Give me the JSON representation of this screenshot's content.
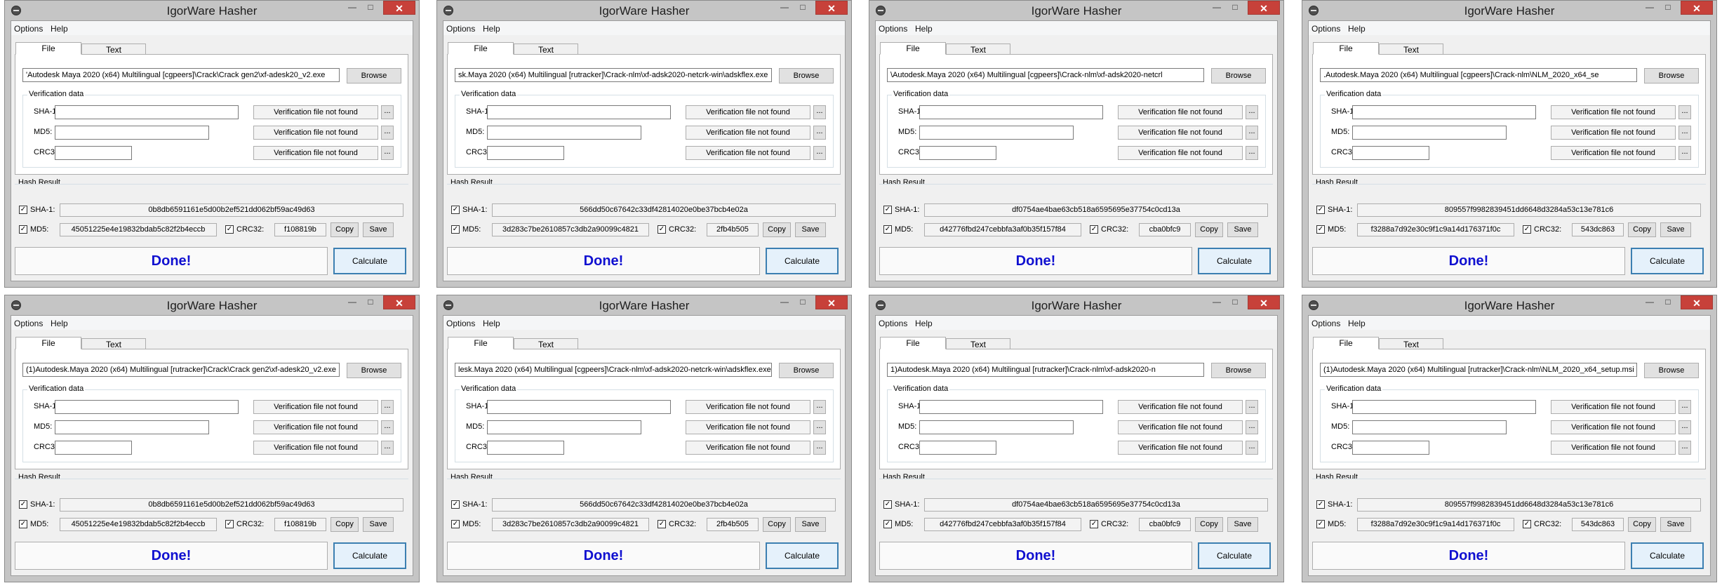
{
  "colors": {
    "accent": "#3c7fb1",
    "done_text": "#1010d0",
    "close_button": "#c7413a"
  },
  "windows": [
    {
      "title": "IgorWare Hasher",
      "menu": [
        "Options",
        "Help"
      ],
      "tabs": [
        "File",
        "Text"
      ],
      "file_path": "'Autodesk Maya 2020 (x64) Multilingual [cgpeers]\\Crack\\Crack gen2\\xf-adesk20_v2.exe",
      "browse_label": "Browse",
      "verification_title": "Verification data",
      "sha1_label": "SHA-1:",
      "md5_label": "MD5:",
      "crc32_label": "CRC32:",
      "verif_status": "Verification file not found",
      "dots_label": "...",
      "hash_result_title": "Hash Result",
      "sha1_hash": "0b8db6591161e5d00b2ef521dd062bf59ac49d63",
      "md5_hash": "45051225e4e19832bdab5c82f2b4eccb",
      "crc32_hash": "f108819b",
      "copy_label": "Copy",
      "save_label": "Save",
      "status": "Done!",
      "calculate_label": "Calculate",
      "minimize_icon": "minimize-icon",
      "maximize_icon": "maximize-icon",
      "close_icon": "close-icon"
    },
    {
      "title": "IgorWare Hasher",
      "menu": [
        "Options",
        "Help"
      ],
      "tabs": [
        "File",
        "Text"
      ],
      "file_path": "sk.Maya 2020 (x64) Multilingual [rutracker]\\Crack-nlm\\xf-adsk2020-netcrk-win\\adskflex.exe",
      "browse_label": "Browse",
      "verification_title": "Verification data",
      "sha1_label": "SHA-1:",
      "md5_label": "MD5:",
      "crc32_label": "CRC32:",
      "verif_status": "Verification file not found",
      "dots_label": "...",
      "hash_result_title": "Hash Result",
      "sha1_hash": "566dd50c67642c33df42814020e0be37bcb4e02a",
      "md5_hash": "3d283c7be2610857c3db2a90099c4821",
      "crc32_hash": "2fb4b505",
      "copy_label": "Copy",
      "save_label": "Save",
      "status": "Done!",
      "calculate_label": "Calculate",
      "minimize_icon": "minimize-icon",
      "maximize_icon": "maximize-icon",
      "close_icon": "close-icon"
    },
    {
      "title": "IgorWare Hasher",
      "menu": [
        "Options",
        "Help"
      ],
      "tabs": [
        "File",
        "Text"
      ],
      "file_path": "\\Autodesk.Maya 2020 (x64) Multilingual [cgpeers]\\Crack-nlm\\xf-adsk2020-netcrl",
      "browse_label": "Browse",
      "verification_title": "Verification data",
      "sha1_label": "SHA-1:",
      "md5_label": "MD5:",
      "crc32_label": "CRC32:",
      "verif_status": "Verification file not found",
      "dots_label": "...",
      "hash_result_title": "Hash Result",
      "sha1_hash": "df0754ae4bae63cb518a6595695e37754c0cd13a",
      "md5_hash": "d42776fbd247cebbfa3af0b35f157f84",
      "crc32_hash": "cba0bfc9",
      "copy_label": "Copy",
      "save_label": "Save",
      "status": "Done!",
      "calculate_label": "Calculate",
      "minimize_icon": "minimize-icon",
      "maximize_icon": "maximize-icon",
      "close_icon": "close-icon"
    },
    {
      "title": "IgorWare Hasher",
      "menu": [
        "Options",
        "Help"
      ],
      "tabs": [
        "File",
        "Text"
      ],
      "file_path": ".Autodesk.Maya 2020 (x64) Multilingual [cgpeers]\\Crack-nlm\\NLM_2020_x64_se",
      "browse_label": "Browse",
      "verification_title": "Verification data",
      "sha1_label": "SHA-1:",
      "md5_label": "MD5:",
      "crc32_label": "CRC32:",
      "verif_status": "Verification file not found",
      "dots_label": "...",
      "hash_result_title": "Hash Result",
      "sha1_hash": "809557f9982839451dd6648d3284a53c13e781c6",
      "md5_hash": "f3288a7d92e30c9f1c9a14d176371f0c",
      "crc32_hash": "543dc863",
      "copy_label": "Copy",
      "save_label": "Save",
      "status": "Done!",
      "calculate_label": "Calculate",
      "minimize_icon": "minimize-icon",
      "maximize_icon": "maximize-icon",
      "close_icon": "close-icon"
    },
    {
      "title": "IgorWare Hasher",
      "menu": [
        "Options",
        "Help"
      ],
      "tabs": [
        "File",
        "Text"
      ],
      "file_path": "(1)Autodesk.Maya 2020 (x64) Multilingual [rutracker]\\Crack\\Crack gen2\\xf-adesk20_v2.exe",
      "browse_label": "Browse",
      "verification_title": "Verification data",
      "sha1_label": "SHA-1:",
      "md5_label": "MD5:",
      "crc32_label": "CRC32:",
      "verif_status": "Verification file not found",
      "dots_label": "...",
      "hash_result_title": "Hash Result",
      "sha1_hash": "0b8db6591161e5d00b2ef521dd062bf59ac49d63",
      "md5_hash": "45051225e4e19832bdab5c82f2b4eccb",
      "crc32_hash": "f108819b",
      "copy_label": "Copy",
      "save_label": "Save",
      "status": "Done!",
      "calculate_label": "Calculate",
      "minimize_icon": "minimize-icon",
      "maximize_icon": "maximize-icon",
      "close_icon": "close-icon"
    },
    {
      "title": "IgorWare Hasher",
      "menu": [
        "Options",
        "Help"
      ],
      "tabs": [
        "File",
        "Text"
      ],
      "file_path": "lesk.Maya 2020 (x64) Multilingual [cgpeers]\\Crack-nlm\\xf-adsk2020-netcrk-win\\adskflex.exe",
      "browse_label": "Browse",
      "verification_title": "Verification data",
      "sha1_label": "SHA-1:",
      "md5_label": "MD5:",
      "crc32_label": "CRC32:",
      "verif_status": "Verification file not found",
      "dots_label": "...",
      "hash_result_title": "Hash Result",
      "sha1_hash": "566dd50c67642c33df42814020e0be37bcb4e02a",
      "md5_hash": "3d283c7be2610857c3db2a90099c4821",
      "crc32_hash": "2fb4b505",
      "copy_label": "Copy",
      "save_label": "Save",
      "status": "Done!",
      "calculate_label": "Calculate",
      "minimize_icon": "minimize-icon",
      "maximize_icon": "maximize-icon",
      "close_icon": "close-icon"
    },
    {
      "title": "IgorWare Hasher",
      "menu": [
        "Options",
        "Help"
      ],
      "tabs": [
        "File",
        "Text"
      ],
      "file_path": "1)Autodesk.Maya 2020 (x64) Multilingual [rutracker]\\Crack-nlm\\xf-adsk2020-n",
      "browse_label": "Browse",
      "verification_title": "Verification data",
      "sha1_label": "SHA-1:",
      "md5_label": "MD5:",
      "crc32_label": "CRC32:",
      "verif_status": "Verification file not found",
      "dots_label": "...",
      "hash_result_title": "Hash Result",
      "sha1_hash": "df0754ae4bae63cb518a6595695e37754c0cd13a",
      "md5_hash": "d42776fbd247cebbfa3af0b35f157f84",
      "crc32_hash": "cba0bfc9",
      "copy_label": "Copy",
      "save_label": "Save",
      "status": "Done!",
      "calculate_label": "Calculate",
      "minimize_icon": "minimize-icon",
      "maximize_icon": "maximize-icon",
      "close_icon": "close-icon"
    },
    {
      "title": "IgorWare Hasher",
      "menu": [
        "Options",
        "Help"
      ],
      "tabs": [
        "File",
        "Text"
      ],
      "file_path": "(1)Autodesk.Maya 2020 (x64) Multilingual [rutracker]\\Crack-nlm\\NLM_2020_x64_setup.msi",
      "browse_label": "Browse",
      "verification_title": "Verification data",
      "sha1_label": "SHA-1:",
      "md5_label": "MD5:",
      "crc32_label": "CRC32:",
      "verif_status": "Verification file not found",
      "dots_label": "...",
      "hash_result_title": "Hash Result",
      "sha1_hash": "809557f9982839451dd6648d3284a53c13e781c6",
      "md5_hash": "f3288a7d92e30c9f1c9a14d176371f0c",
      "crc32_hash": "543dc863",
      "copy_label": "Copy",
      "save_label": "Save",
      "status": "Done!",
      "calculate_label": "Calculate",
      "minimize_icon": "minimize-icon",
      "maximize_icon": "maximize-icon",
      "close_icon": "close-icon"
    }
  ]
}
